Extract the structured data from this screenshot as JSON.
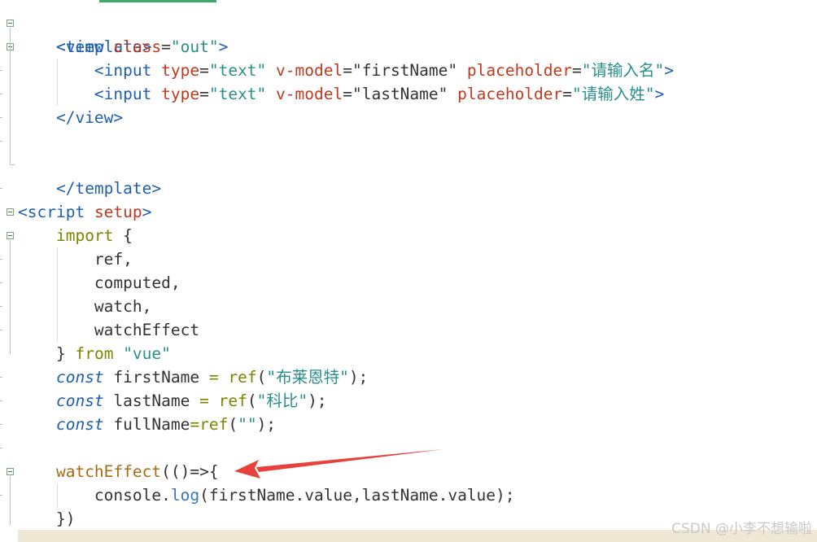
{
  "code": {
    "template_open": "<template>",
    "view_open_start": "<view",
    "class_attr": "class",
    "out_value": "\"out\"",
    "gt": ">",
    "input_tag": "<input",
    "type_attr": "type",
    "text_value": "\"text\"",
    "vmodel_attr": "v-model",
    "firstname_value": "\"firstName\"",
    "lastname_value": "\"lastName\"",
    "placeholder_attr": "placeholder",
    "placeholder_first": "\"请输入名\"",
    "placeholder_last": "\"请输入姓\"",
    "eq": "=",
    "view_close": "</view>",
    "template_close": "</template>",
    "script_open": "<script",
    "setup_attr": "setup",
    "import_kw": "import",
    "brace_open": "{",
    "ref_item": "ref,",
    "computed_item": "computed,",
    "watch_item": "watch,",
    "watcheffect_item": "watchEffect",
    "brace_close": "}",
    "from_kw": "from",
    "vue_str": "\"vue\"",
    "const_kw": "const",
    "firstname_var": "firstName",
    "lastname_var": "lastName",
    "fullname_var": "fullName",
    "ref_fn": "ref",
    "paren_open": "(",
    "paren_close_semi": ");",
    "name_bulaient": "\"布莱恩特\"",
    "name_kebi": "\"科比\"",
    "empty_str": "\"\"",
    "watcheffect_fn": "watchEffect",
    "arrow_open": "(()=>",
    "console_obj": "console",
    "dot": ".",
    "log_fn": "log",
    "log_args": "(firstName.value,lastName.value);",
    "block_close": "})"
  },
  "annotation": {
    "arrow_color": "#e8413c"
  },
  "watermark": "CSDN @小李不想输啦"
}
